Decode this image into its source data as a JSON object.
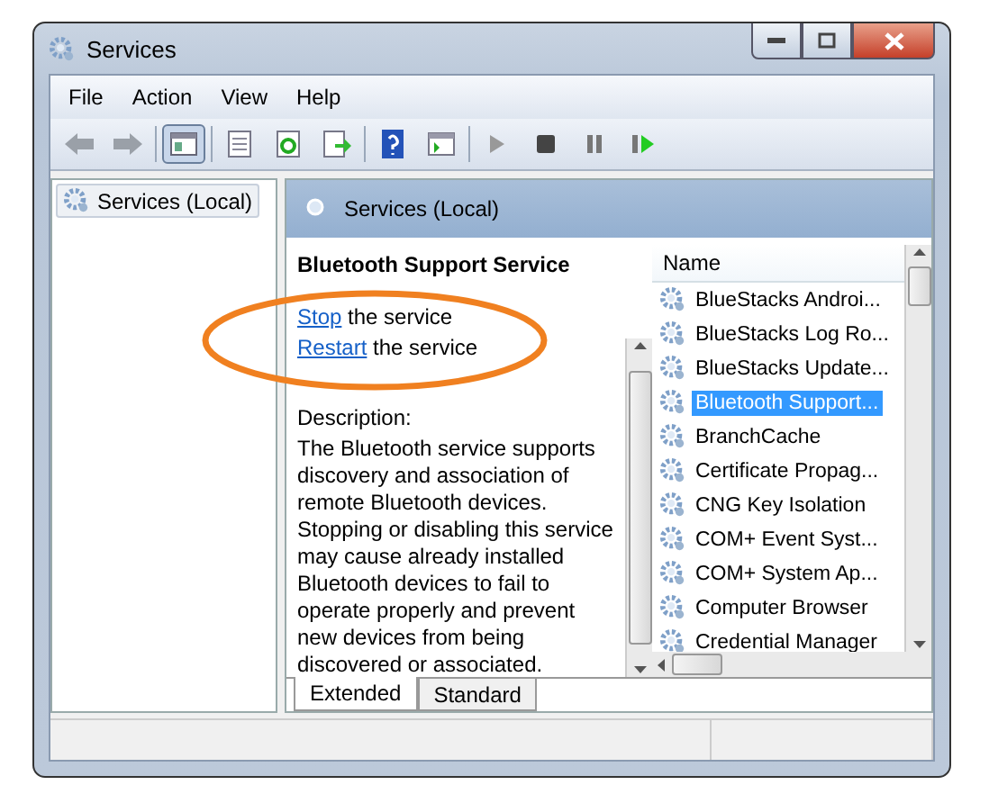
{
  "window": {
    "title": "Services"
  },
  "menu": [
    "File",
    "Action",
    "View",
    "Help"
  ],
  "toolbar": [
    {
      "kind": "back",
      "pressed": false
    },
    {
      "kind": "forward",
      "pressed": false
    },
    {
      "kind": "sep"
    },
    {
      "kind": "console",
      "pressed": true
    },
    {
      "kind": "sep"
    },
    {
      "kind": "properties",
      "pressed": false
    },
    {
      "kind": "refresh",
      "pressed": false
    },
    {
      "kind": "export",
      "pressed": false
    },
    {
      "kind": "sep"
    },
    {
      "kind": "help",
      "pressed": false
    },
    {
      "kind": "pane",
      "pressed": false
    },
    {
      "kind": "sep"
    },
    {
      "kind": "play",
      "pressed": false
    },
    {
      "kind": "stop",
      "pressed": false
    },
    {
      "kind": "pause",
      "pressed": false
    },
    {
      "kind": "resume",
      "pressed": false
    }
  ],
  "tree": [
    {
      "label": "Services (Local)",
      "selected": true
    }
  ],
  "header": {
    "title": "Services (Local)"
  },
  "detail": {
    "title": "Bluetooth Support Service",
    "actions": [
      {
        "link": "Stop",
        "text": "the service"
      },
      {
        "link": "Restart",
        "text": "the service"
      }
    ],
    "description_label": "Description:",
    "description": "The Bluetooth service supports discovery and association of remote Bluetooth devices. Stopping or disabling this service may cause already installed Bluetooth devices to fail to operate properly and prevent new devices from being discovered or associated."
  },
  "list": {
    "column": "Name",
    "rows": [
      {
        "name": "BlueStacks Androi...",
        "selected": false
      },
      {
        "name": "BlueStacks Log Ro...",
        "selected": false
      },
      {
        "name": "BlueStacks Update...",
        "selected": false
      },
      {
        "name": "Bluetooth Support...",
        "selected": true
      },
      {
        "name": "BranchCache",
        "selected": false
      },
      {
        "name": "Certificate Propag...",
        "selected": false
      },
      {
        "name": "CNG Key Isolation",
        "selected": false
      },
      {
        "name": "COM+ Event Syst...",
        "selected": false
      },
      {
        "name": "COM+ System Ap...",
        "selected": false
      },
      {
        "name": "Computer Browser",
        "selected": false
      },
      {
        "name": "Credential Manager",
        "selected": false
      }
    ]
  },
  "tabs": [
    {
      "label": "Extended",
      "selected": true
    },
    {
      "label": "Standard",
      "selected": false
    }
  ]
}
